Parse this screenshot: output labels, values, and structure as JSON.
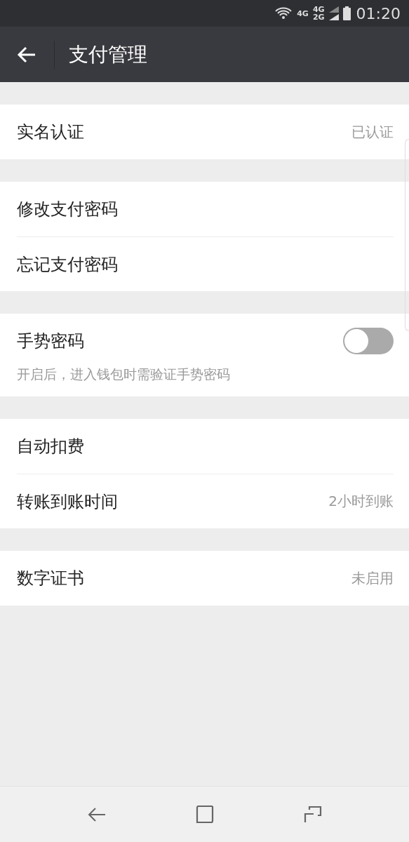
{
  "status_bar": {
    "network_labels": [
      "4G",
      "4G",
      "2G"
    ],
    "time": "01:20"
  },
  "header": {
    "title": "支付管理"
  },
  "groups": [
    {
      "items": [
        {
          "kind": "link",
          "label": "实名认证",
          "value": "已认证"
        }
      ]
    },
    {
      "items": [
        {
          "kind": "link",
          "label": "修改支付密码"
        },
        {
          "kind": "link",
          "label": "忘记支付密码"
        }
      ]
    },
    {
      "items": [
        {
          "kind": "toggle",
          "label": "手势密码",
          "on": false,
          "description": "开启后，进入钱包时需验证手势密码"
        }
      ]
    },
    {
      "items": [
        {
          "kind": "link",
          "label": "自动扣费"
        },
        {
          "kind": "link",
          "label": "转账到账时间",
          "value": "2小时到账"
        }
      ]
    },
    {
      "items": [
        {
          "kind": "link",
          "label": "数字证书",
          "value": "未启用"
        }
      ]
    }
  ]
}
